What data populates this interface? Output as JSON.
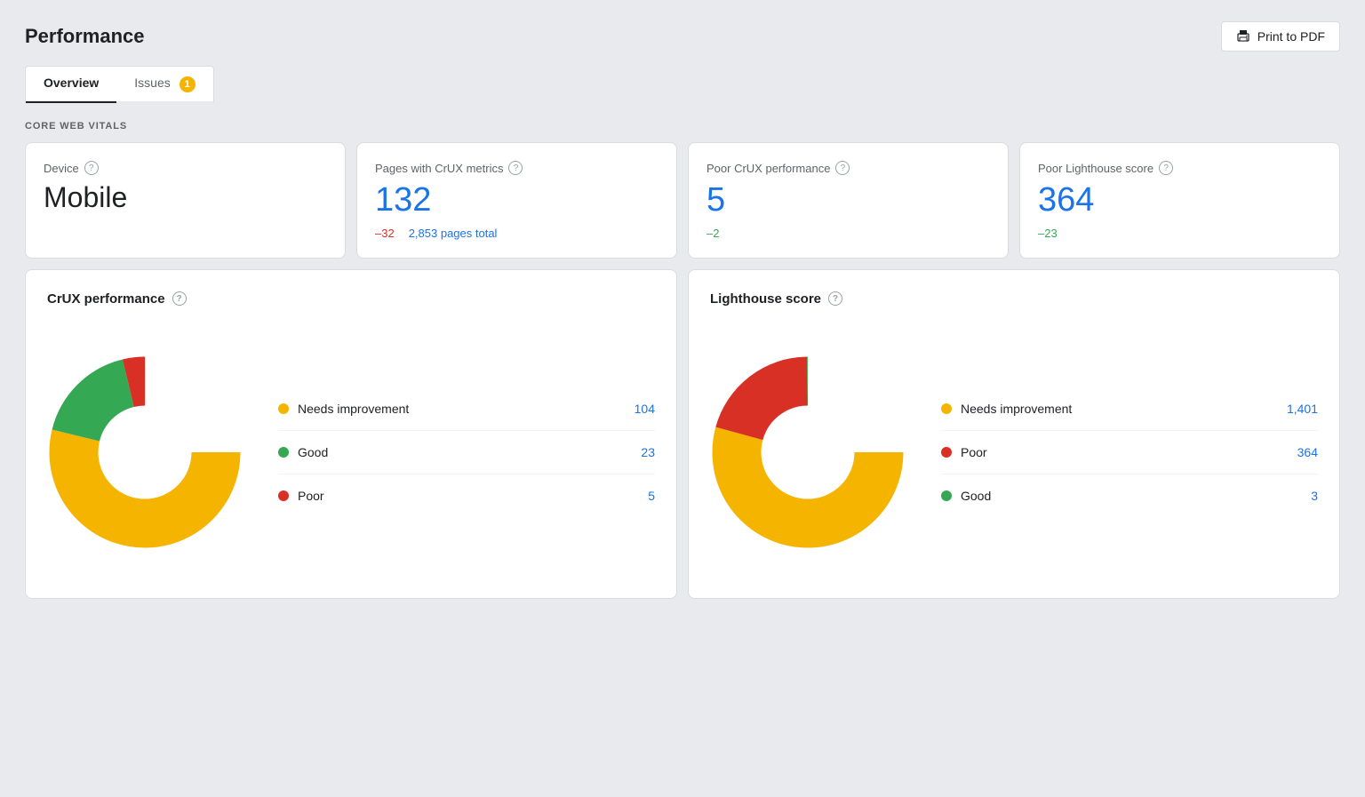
{
  "page": {
    "title": "Performance",
    "print_button": "Print to PDF"
  },
  "tabs": [
    {
      "id": "overview",
      "label": "Overview",
      "active": true,
      "badge": null
    },
    {
      "id": "issues",
      "label": "Issues",
      "active": false,
      "badge": "1"
    }
  ],
  "section_label": "CORE WEB VITALS",
  "metric_cards": [
    {
      "id": "device",
      "label": "Device",
      "value": "Mobile",
      "value_color": "device",
      "sub": []
    },
    {
      "id": "pages_with_crux",
      "label": "Pages with CrUX metrics",
      "value": "132",
      "value_color": "blue",
      "sub": [
        {
          "text": "–32",
          "color": "negative"
        },
        {
          "text": "2,853 pages total",
          "color": "positive"
        }
      ]
    },
    {
      "id": "poor_crux",
      "label": "Poor CrUX performance",
      "value": "5",
      "value_color": "blue",
      "sub": [
        {
          "text": "–2",
          "color": "green"
        }
      ]
    },
    {
      "id": "poor_lighthouse",
      "label": "Poor Lighthouse score",
      "value": "364",
      "value_color": "blue",
      "sub": [
        {
          "text": "–23",
          "color": "green"
        }
      ]
    }
  ],
  "charts": [
    {
      "id": "crux",
      "title": "CrUX performance",
      "legend": [
        {
          "label": "Needs improvement",
          "color": "#f5b400",
          "value": "104"
        },
        {
          "label": "Good",
          "color": "#34a853",
          "value": "23"
        },
        {
          "label": "Poor",
          "color": "#d93025",
          "value": "5"
        }
      ],
      "donut": {
        "segments": [
          {
            "label": "Needs improvement",
            "color": "#f5b400",
            "value": 104
          },
          {
            "label": "Good",
            "color": "#34a853",
            "value": 23
          },
          {
            "label": "Poor",
            "color": "#d93025",
            "value": 5
          }
        ],
        "total": 132
      }
    },
    {
      "id": "lighthouse",
      "title": "Lighthouse score",
      "legend": [
        {
          "label": "Needs improvement",
          "color": "#f5b400",
          "value": "1,401"
        },
        {
          "label": "Poor",
          "color": "#d93025",
          "value": "364"
        },
        {
          "label": "Good",
          "color": "#34a853",
          "value": "3"
        }
      ],
      "donut": {
        "segments": [
          {
            "label": "Needs improvement",
            "color": "#f5b400",
            "value": 1401
          },
          {
            "label": "Poor",
            "color": "#d93025",
            "value": 364
          },
          {
            "label": "Good",
            "color": "#34a853",
            "value": 3
          }
        ],
        "total": 1768
      }
    }
  ],
  "help_icon_label": "?"
}
